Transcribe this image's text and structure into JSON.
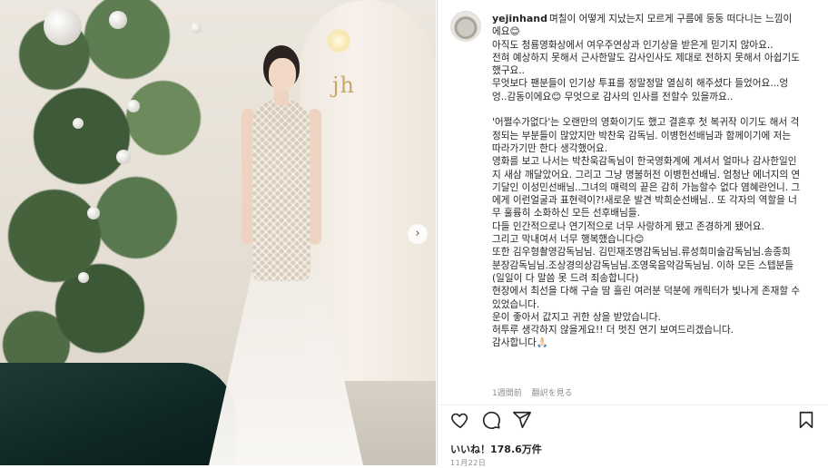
{
  "photo": {
    "sign_text": "jh",
    "next_arrow": "›"
  },
  "post": {
    "username": "yejinhand",
    "caption_lines": [
      "며칠이 어떻게 지났는지 모르게 구름에 둥둥 떠다니는 느낌이",
      "에요😊",
      "아직도 청룡영화상에서 여우주연상과 인기상을 받은게 믿기지 않아요..",
      "전혀 예상하지 못해서 근사한말도 감사인사도 제대로 전하지 못해서 아쉽기도",
      "했구요..",
      "무엇보다 팬분들이 인기상 투표를 정말정말 열심히 해주셨다 들었어요...엉",
      "엉..감동이에요😊 무엇으로 감사의 인사를 전할수 있을까요..",
      "",
      "'어쩔수가없다'는 오랜만의 영화이기도 했고 결혼후 첫 복귀작 이기도 해서 걱",
      "정되는 부분들이 많았지만 박찬욱 감독님. 이병헌선배님과 함께이기에 저는",
      "따라가기만 한다 생각했어요.",
      "영화를 보고 나서는 박찬욱감독님이 한국영화계에 계셔서 얼마나 감사한일인",
      "지 새삼 깨달았어요. 그리고 그냥 명불허전 이병헌선배님. 엄청난 에너지의 연",
      "기달인 이성민선배님..그녀의 매력의 끝은 감히 가늠할수 없다 염혜란언니. 그",
      "에게 이런얼굴과 표현력이?!새로운 발견 박희순선배님.. 또 각자의 역할을 너",
      "무 훌륭히 소화하신 모든 선후배님들.",
      "다들 인간적으로나 연기적으로 너무 사랑하게 됐고 존경하게 됐어요.",
      "그리고 막내여서 너무 행복했습니다😊",
      "또한 김우형촬영감독님님. 김민재조명감독님님.류성희미술감독님님.송종희",
      "분장감독님님.조상경의상감독님님.조영욱음악감독님님. 이하 모든 스텝분들",
      "(일일이 다 말씀 못 드려 죄송합니다)",
      "현장에서 최선을 다해 구슬 땀 흘린 여러분 덕분에 캐릭터가 빛나게 존재할 수",
      "있었습니다.",
      "운이 좋아서 값지고 귀한 상을 받았습니다.",
      "허투루 생각하지 않을게요!! 더 멋진 연기 보여드리겠습니다.",
      "감사합니다🙏🏻"
    ],
    "time_ago": "1週間前",
    "translate_link": "翻訳を見る",
    "likes_text": "いいね！178.6万件",
    "date_text": "11月22日"
  },
  "icons": {
    "like": "heart-icon",
    "comment": "comment-icon",
    "share": "share-icon",
    "save": "bookmark-icon"
  }
}
